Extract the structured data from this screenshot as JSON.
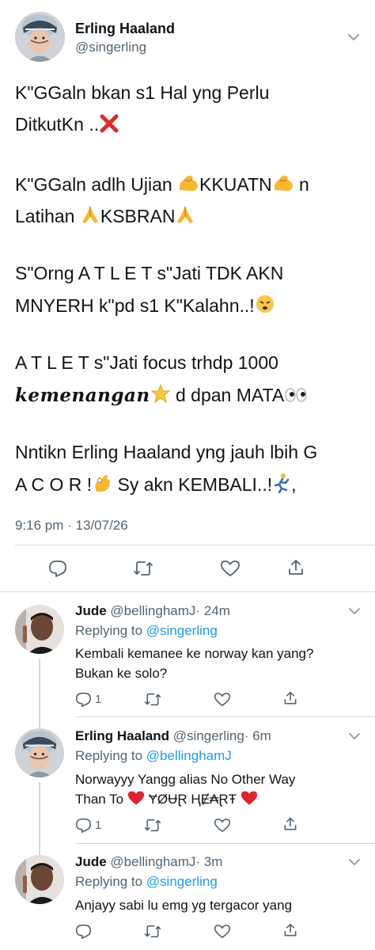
{
  "main_tweet": {
    "author_name": "Erling Haaland",
    "author_handle": "@singerling",
    "lines": [
      "K\"GGaln bkan s1 Hal yng Perlu",
      "DitkutKn ..",
      "K\"GGaln adlh Ujian ",
      "KKUATN",
      " n",
      "Latihan ",
      "KSBRAN",
      "S\"Orng A T L E T s\"Jati TDK AKN",
      "MNYERH k\"pd s1 K\"Kalahn..!",
      "A T L E T s\"Jati focus trhdp 1000",
      "kemenangan",
      " d dpan MATA",
      "Nntikn Erling Haaland yng jauh lbih G",
      "A C O R !",
      " Sy akn KEMBALI..!",
      ","
    ],
    "timestamp": "9:16 pm · 13/07/26",
    "emojis": [
      "cross-mark",
      "flexed-biceps",
      "folded-hands",
      "steaming-face",
      "star",
      "eyes",
      "ok-hand",
      "running-person"
    ]
  },
  "replies": [
    {
      "author_name": "Jude",
      "author_handle": "@bellinghamJ",
      "time": "· 24m",
      "replying_label": "Replying to ",
      "replying_to": "@singerling",
      "lines": [
        "Kembali kemanee ke norway kan yang?",
        "Bukan ke solo?"
      ],
      "reply_count": "1"
    },
    {
      "author_name": "Erling Haaland",
      "author_handle": "@singerling",
      "time": "· 6m",
      "replying_label": "Replying to ",
      "replying_to": "@bellinghamJ",
      "lines": [
        "Norwayyy Yangg alias No Other Way",
        "Than To ",
        "ɎØɄⱤ ⱧɆ₳ⱤŦ"
      ],
      "reply_count": "1"
    },
    {
      "author_name": "Jude",
      "author_handle": "@bellinghamJ",
      "time": "· 3m",
      "replying_label": "Replying to ",
      "replying_to": "@singerling",
      "lines": [
        "Anjayy sabi lu emg yg tergacor yang"
      ],
      "reply_count": ""
    }
  ],
  "colors": {
    "text": "#0f1419",
    "secondary": "#536471",
    "link": "#1d9bf0",
    "divider": "#cfd9de"
  }
}
